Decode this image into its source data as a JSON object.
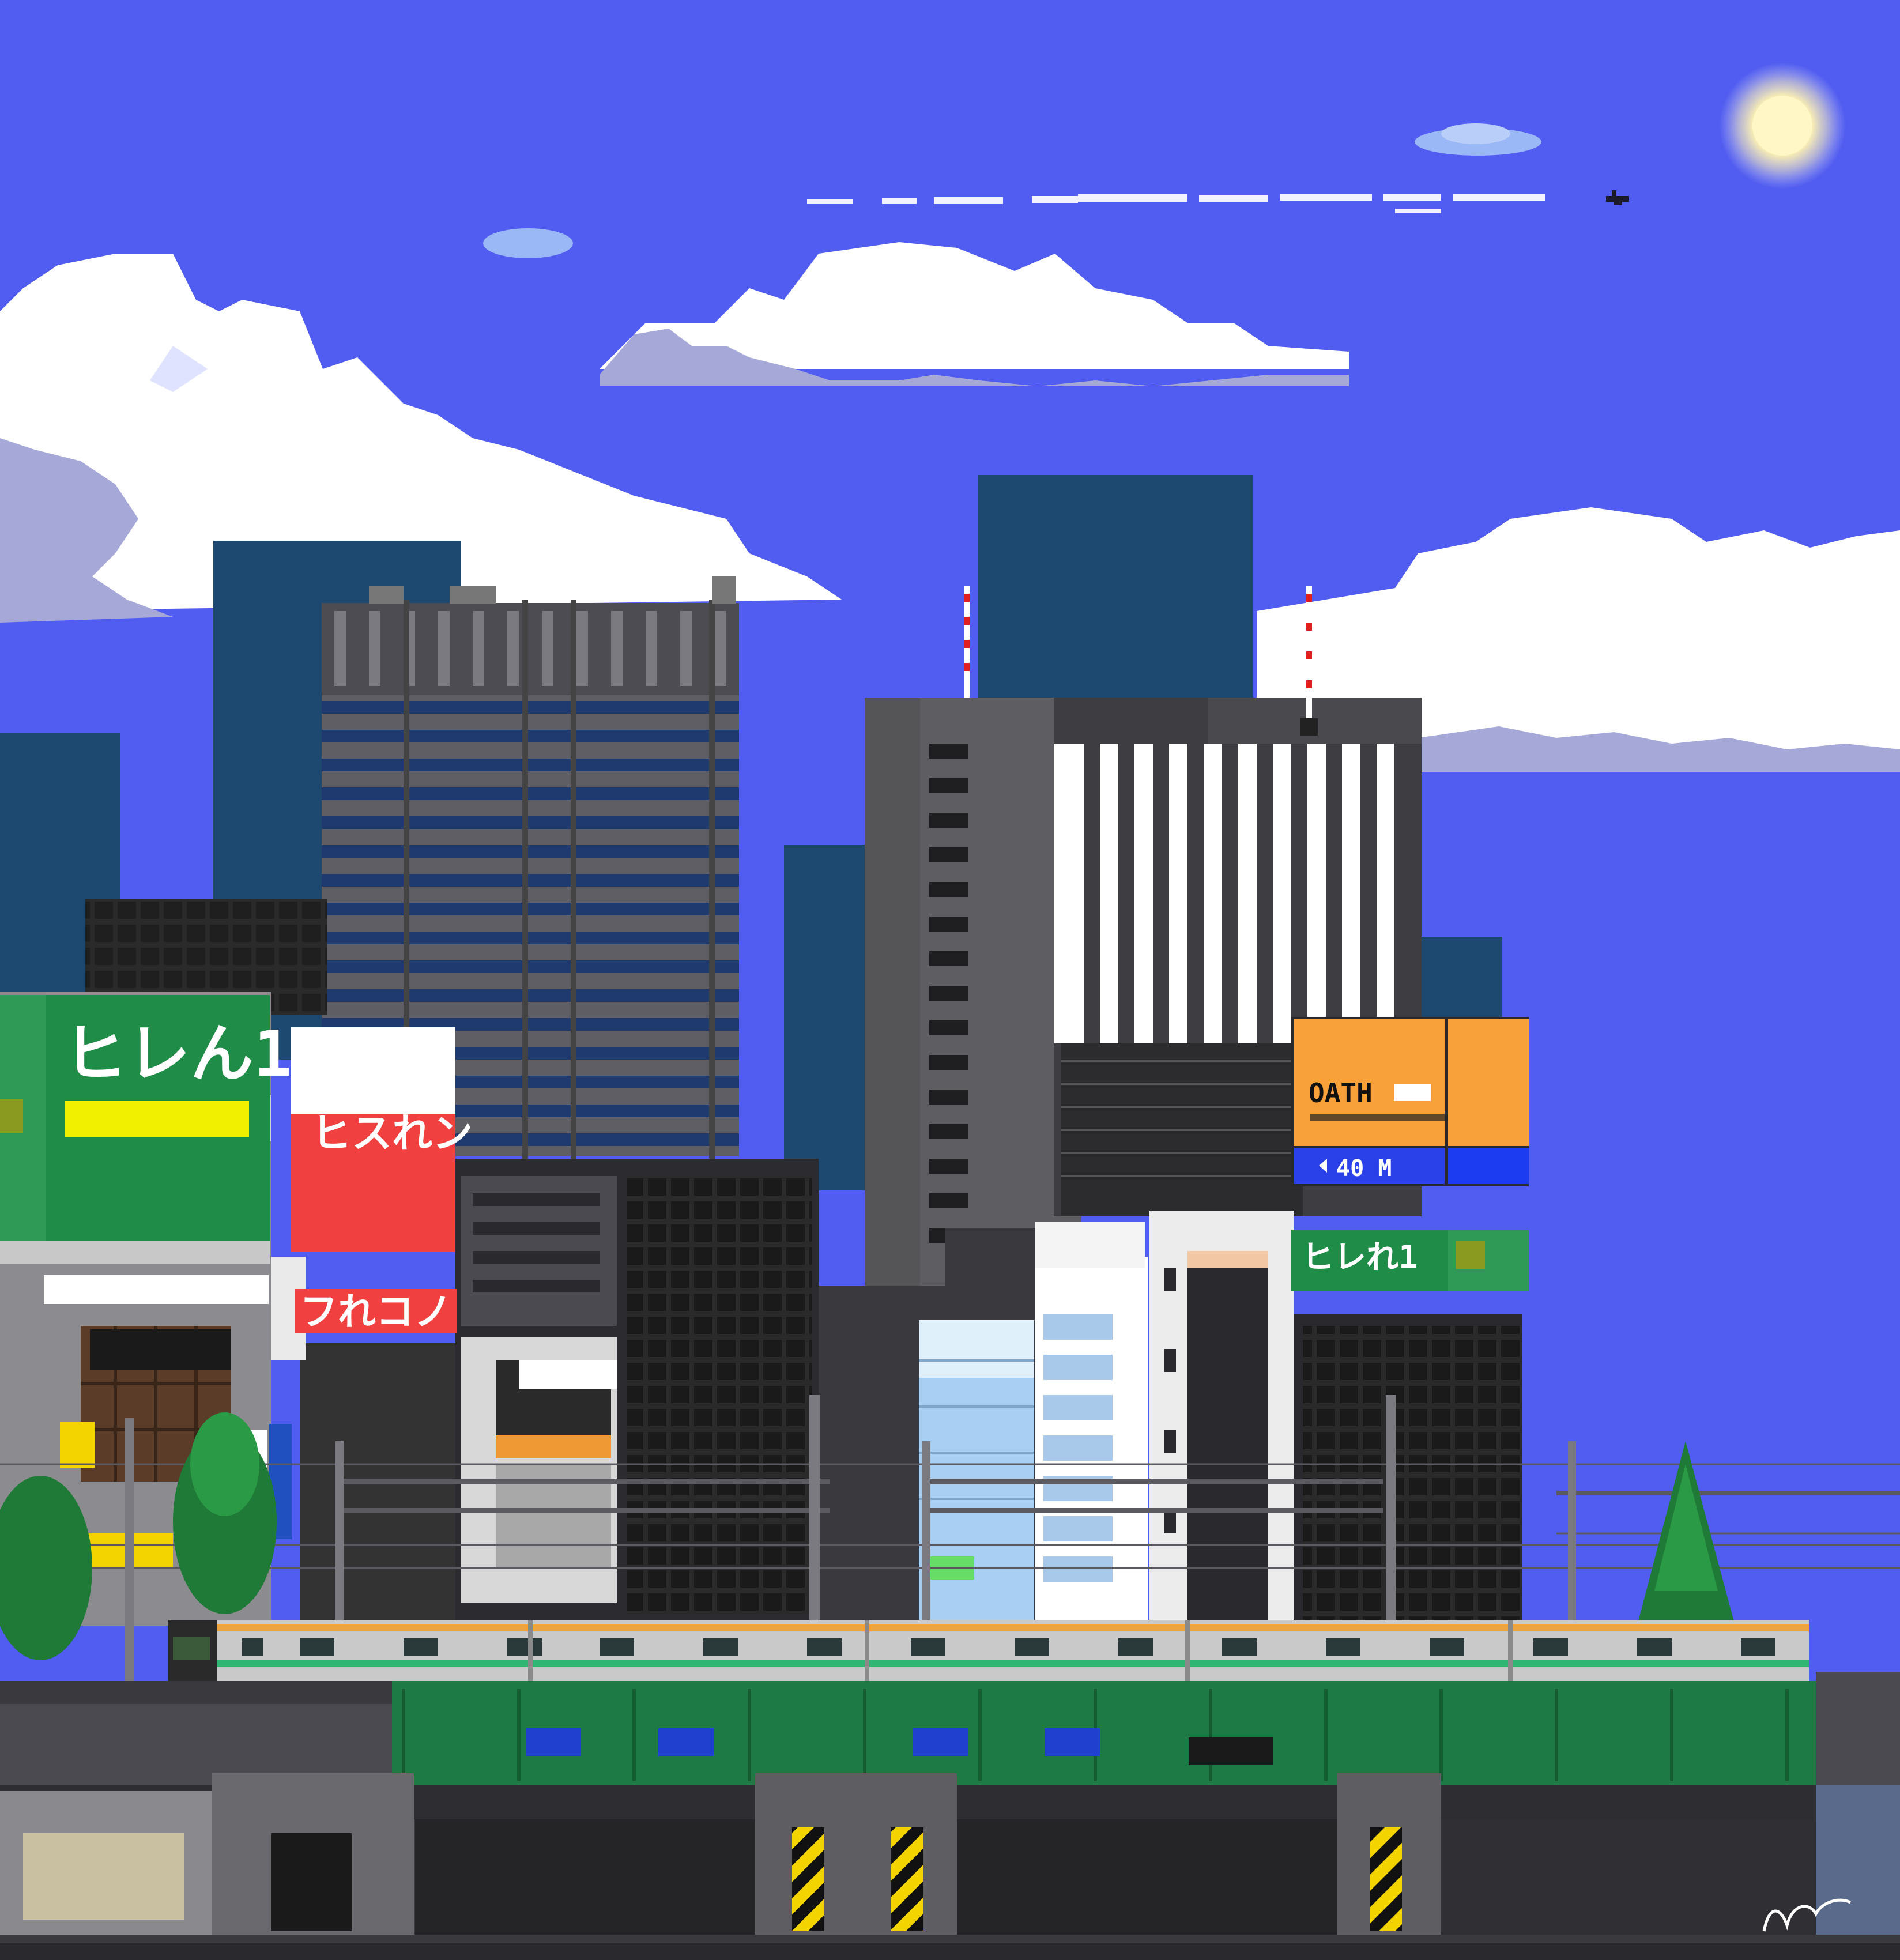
{
  "colors": {
    "sky": "#515cf0",
    "cloud": "#ffffff",
    "cloud_shadow": "#a6a8d8",
    "far_building": "#1d4870",
    "sun": "#fff7c0",
    "train_body": "#c9c9c9",
    "train_stripe_orange": "#f4a23a",
    "train_stripe_green": "#2fb673",
    "viaduct_green": "#1e7a45",
    "billboard_green": "#1f8c47",
    "billboard_red": "#f04040",
    "billboard_orange": "#f8a03a",
    "billboard_blue": "#1b3cf0"
  },
  "signs": {
    "green_billboard_pseudo": "ヒレん1",
    "red_billboard_pseudo": "ヒスれン",
    "red_lower_pseudo": "フれコノ",
    "oath_title": "OATH",
    "oath_distance": "40 M",
    "small_green_pseudo": "ヒレれ1"
  },
  "objects": {
    "sun": "sun",
    "airplane": "airplane-icon",
    "train": "commuter-train",
    "viaduct": "railway-viaduct",
    "signature": "artist-signature"
  }
}
